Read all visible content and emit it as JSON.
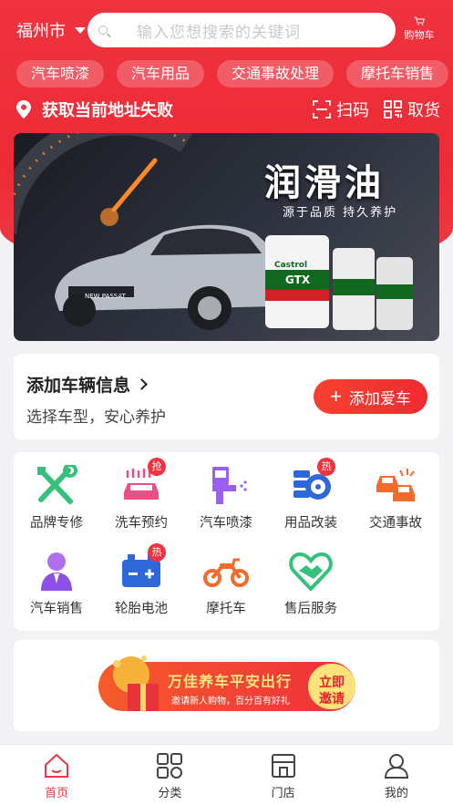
{
  "header": {
    "city": "福州市",
    "search_placeholder": "输入您想搜索的关键词",
    "cart_label": "购物车"
  },
  "tags": [
    "汽车喷漆",
    "汽车用品",
    "交通事故处理",
    "摩托车销售"
  ],
  "location": {
    "text": "获取当前地址失败",
    "scan_label": "扫码",
    "pickup_label": "取货"
  },
  "banner": {
    "title": "润滑油",
    "subtitle": "源于品质  持久养护",
    "car_plate": "NEW PASSAT",
    "product_brand": "Castrol",
    "product_name": "GTX"
  },
  "car_card": {
    "title": "添加车辆信息",
    "subtitle": "选择车型，安心养护",
    "button_label": "添加爱车"
  },
  "services": [
    {
      "label": "品牌专修",
      "icon": "wrench-screwdriver-icon",
      "badge": ""
    },
    {
      "label": "洗车预约",
      "icon": "car-wash-icon",
      "badge": "抢"
    },
    {
      "label": "汽车喷漆",
      "icon": "spray-gun-icon",
      "badge": ""
    },
    {
      "label": "用品改装",
      "icon": "tire-parts-icon",
      "badge": "热"
    },
    {
      "label": "交通事故",
      "icon": "car-collision-icon",
      "badge": ""
    },
    {
      "label": "汽车销售",
      "icon": "salesperson-icon",
      "badge": ""
    },
    {
      "label": "轮胎电池",
      "icon": "battery-icon",
      "badge": "热"
    },
    {
      "label": "摩托车",
      "icon": "motorcycle-icon",
      "badge": ""
    },
    {
      "label": "售后服务",
      "icon": "heart-handshake-icon",
      "badge": ""
    }
  ],
  "promo": {
    "title": "万佳养车平安出行",
    "subtitle": "邀请新人购物，百分百有好礼",
    "button_line1": "立即",
    "button_line2": "邀请"
  },
  "tabbar": [
    {
      "label": "首页",
      "icon": "home-icon",
      "active": true
    },
    {
      "label": "分类",
      "icon": "category-grid-icon",
      "active": false
    },
    {
      "label": "门店",
      "icon": "store-icon",
      "active": false
    },
    {
      "label": "我的",
      "icon": "user-icon",
      "active": false
    }
  ],
  "colors": {
    "brand_red": "#ef333f",
    "accent_green": "#34c27a",
    "accent_pink": "#ee4d87",
    "accent_purple": "#9b5ff0",
    "accent_blue": "#2e68d8",
    "accent_orange": "#f36b2a"
  }
}
